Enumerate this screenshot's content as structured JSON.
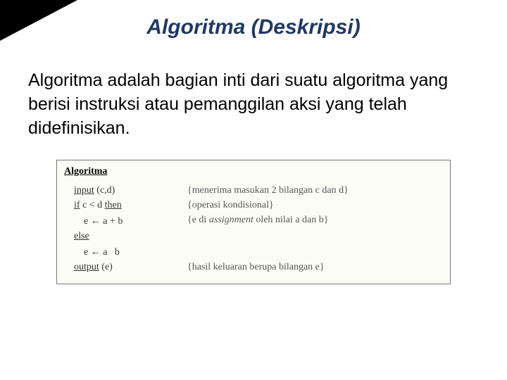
{
  "title": "Algoritma (Deskripsi)",
  "paragraph": "Algoritma adalah bagian inti dari suatu algoritma yang berisi instruksi atau pemanggilan aksi yang telah didefinisikan.",
  "code": {
    "label": "Algoritma",
    "lines": [
      {
        "left_html": "<span class='kw'>input</span> (c,d)",
        "comment": "{menerima masukan 2 bilangan c dan d}"
      },
      {
        "left_html": "<span class='kw'>if</span> c &lt; d <span class='kw'>then</span>",
        "comment": "{operasi kondisional}"
      },
      {
        "left_html": "&nbsp;&nbsp;&nbsp;&nbsp;e <span class='arrow'>←</span> a + b",
        "comment": "{e di <i>assignment</i> oleh nilai a dan b}"
      },
      {
        "left_html": "<span class='kw'>else</span>",
        "comment": ""
      },
      {
        "left_html": "&nbsp;&nbsp;&nbsp;&nbsp;e <span class='arrow'>←</span> a &nbsp; b",
        "comment": ""
      },
      {
        "left_html": "<span class='kw'>output</span> (e)",
        "comment": "{hasil keluaran berupa bilangan e}"
      }
    ]
  }
}
